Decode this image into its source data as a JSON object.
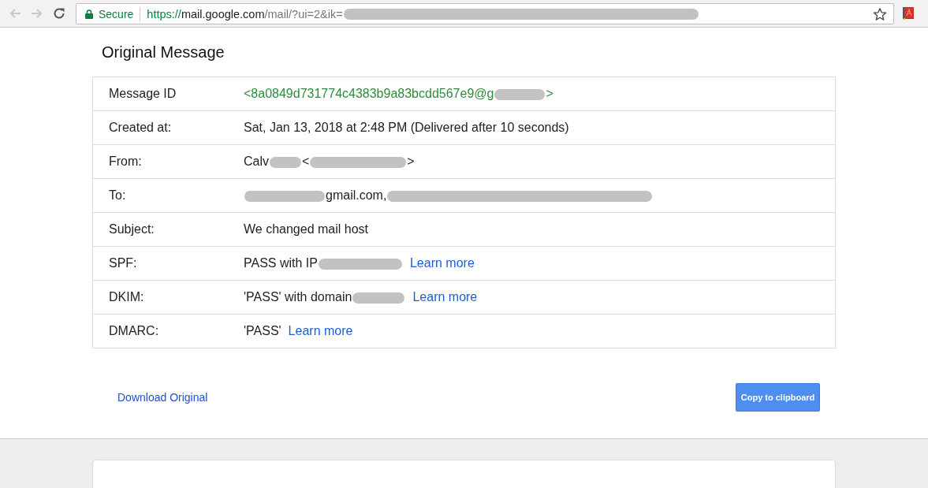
{
  "browser": {
    "nav_buttons": [
      {
        "kind": "back",
        "disabled": true
      },
      {
        "kind": "forward",
        "disabled": true
      },
      {
        "kind": "reload",
        "disabled": false
      }
    ],
    "security_label": "Secure",
    "url": [
      {
        "kind": "scheme",
        "text": "https://"
      },
      {
        "kind": "host",
        "text": "mail.google.com"
      },
      {
        "kind": "path",
        "text": "/mail/?ui=2&ik="
      },
      {
        "kind": "redacted"
      }
    ],
    "bookmarked": false
  },
  "page": {
    "title": "Original Message",
    "rows": [
      {
        "label": "Message ID",
        "value": [
          {
            "kind": "id",
            "text": "<8a0849d731774c4383b9a83bcdd567e9@g"
          },
          {
            "kind": "redacted"
          },
          {
            "kind": "id",
            "text": ">"
          }
        ]
      },
      {
        "label": "Created at:",
        "value": [
          {
            "kind": "text",
            "text": "Sat, Jan 13, 2018 at 2:48 PM (Delivered after 10 seconds)"
          }
        ]
      },
      {
        "label": "From:",
        "value": [
          {
            "kind": "text",
            "text": "Calv"
          },
          {
            "kind": "redacted"
          },
          {
            "kind": "text",
            "text": "<"
          },
          {
            "kind": "redacted"
          },
          {
            "kind": "text",
            "text": ">"
          }
        ]
      },
      {
        "label": "To:",
        "value": [
          {
            "kind": "redacted"
          },
          {
            "kind": "text",
            "text": "gmail.com,"
          },
          {
            "kind": "redacted"
          }
        ]
      },
      {
        "label": "Subject:",
        "value": [
          {
            "kind": "text",
            "text": "We changed mail host"
          }
        ]
      },
      {
        "label": "SPF:",
        "value": [
          {
            "kind": "text",
            "text": "PASS with IP"
          },
          {
            "kind": "redacted"
          },
          {
            "kind": "link",
            "text": "Learn more"
          }
        ]
      },
      {
        "label": "DKIM:",
        "value": [
          {
            "kind": "text",
            "text": "'PASS' with domain"
          },
          {
            "kind": "redacted"
          },
          {
            "kind": "link",
            "text": "Learn more"
          }
        ]
      },
      {
        "label": "DMARC:",
        "value": [
          {
            "kind": "text",
            "text": "'PASS'"
          },
          {
            "kind": "link",
            "text": "Learn more"
          }
        ]
      }
    ],
    "download_link": "Download Original",
    "copy_button": "Copy to clipboard"
  }
}
